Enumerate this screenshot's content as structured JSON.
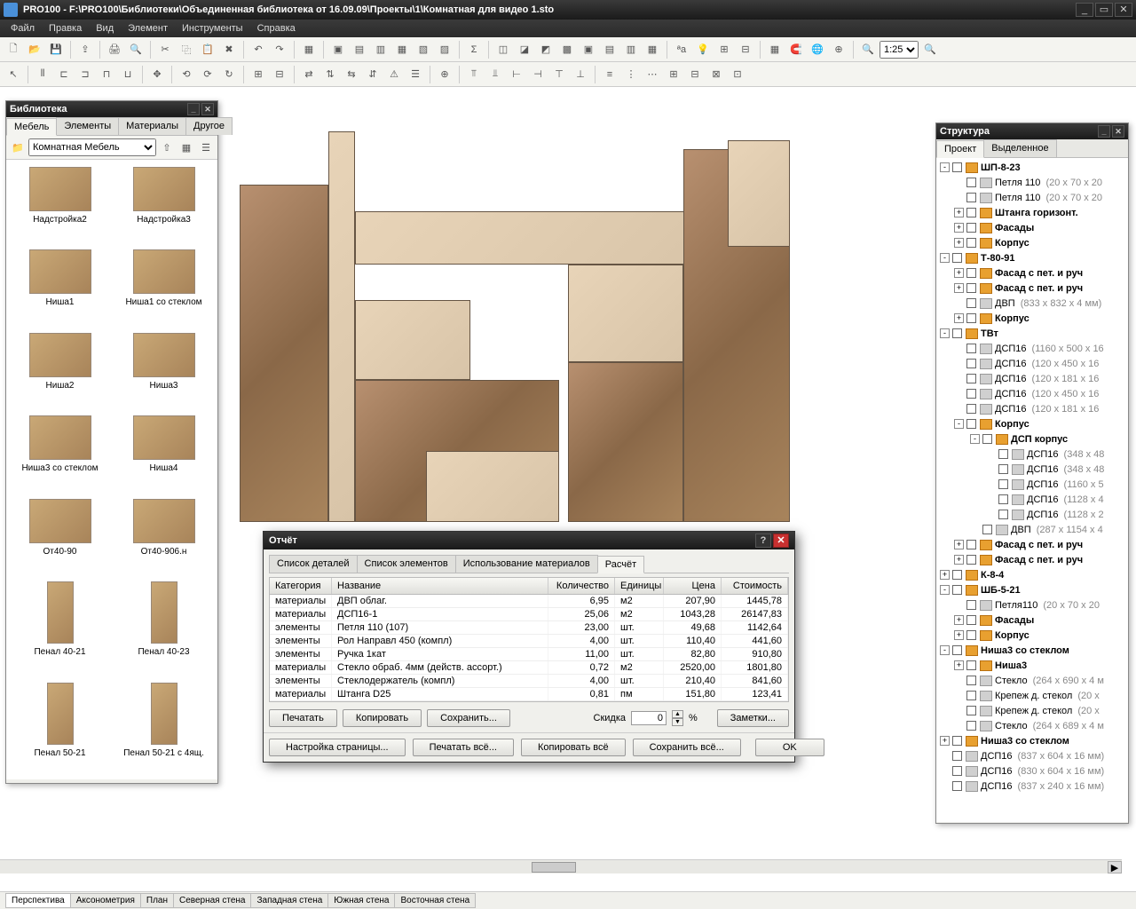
{
  "app": {
    "title": "PRO100 - F:\\PRO100\\Библиотеки\\Объединенная библиотека от 16.09.09\\Проекты\\1\\Комнатная для видео 1.sto"
  },
  "menu": [
    "Файл",
    "Правка",
    "Вид",
    "Элемент",
    "Инструменты",
    "Справка"
  ],
  "zoom": "1:25",
  "library": {
    "title": "Библиотека",
    "tabs": [
      "Мебель",
      "Элементы",
      "Материалы",
      "Другое"
    ],
    "active_tab": 0,
    "folder": "Комнатная Мебель",
    "items": [
      {
        "label": "Надстройка2"
      },
      {
        "label": "Надстройка3"
      },
      {
        "label": "Ниша1"
      },
      {
        "label": "Ниша1 со стеклом"
      },
      {
        "label": "Ниша2"
      },
      {
        "label": "Ниша3"
      },
      {
        "label": "Ниша3 со стеклом"
      },
      {
        "label": "Ниша4"
      },
      {
        "label": "От40-90"
      },
      {
        "label": "От40-906.н"
      },
      {
        "label": "Пенал 40-21",
        "tall": true
      },
      {
        "label": "Пенал 40-23",
        "tall": true
      },
      {
        "label": "Пенал 50-21",
        "tall": true
      },
      {
        "label": "Пенал 50-21 с 4ящ.",
        "tall": true
      }
    ]
  },
  "structure": {
    "title": "Структура",
    "tabs": [
      "Проект",
      "Выделенное"
    ],
    "active_tab": 0,
    "tree": [
      {
        "ind": 0,
        "exp": "-",
        "nm": "ШП-8-23",
        "grp": true
      },
      {
        "ind": 1,
        "nm": "Петля 110",
        "dim": "(20 x 70 x 20",
        "grp": false
      },
      {
        "ind": 1,
        "nm": "Петля 110",
        "dim": "(20 x 70 x 20",
        "grp": false
      },
      {
        "ind": 1,
        "exp": "+",
        "nm": "Штанга горизонт.",
        "grp": true
      },
      {
        "ind": 1,
        "exp": "+",
        "nm": "Фасады",
        "grp": true
      },
      {
        "ind": 1,
        "exp": "+",
        "nm": "Корпус",
        "grp": true
      },
      {
        "ind": 0,
        "exp": "-",
        "nm": "Т-80-91",
        "grp": true
      },
      {
        "ind": 1,
        "exp": "+",
        "nm": "Фасад с пет. и руч",
        "grp": true
      },
      {
        "ind": 1,
        "exp": "+",
        "nm": "Фасад с пет. и руч",
        "grp": true
      },
      {
        "ind": 1,
        "nm": "ДВП",
        "dim": "(833 x 832 x 4 мм)",
        "grp": false
      },
      {
        "ind": 1,
        "exp": "+",
        "nm": "Корпус",
        "grp": true
      },
      {
        "ind": 0,
        "exp": "-",
        "nm": "ТВт",
        "grp": true
      },
      {
        "ind": 1,
        "nm": "ДСП16",
        "dim": "(1160 x 500 x 16",
        "grp": false
      },
      {
        "ind": 1,
        "nm": "ДСП16",
        "dim": "(120 x 450 x 16",
        "grp": false
      },
      {
        "ind": 1,
        "nm": "ДСП16",
        "dim": "(120 x 181 x 16",
        "grp": false
      },
      {
        "ind": 1,
        "nm": "ДСП16",
        "dim": "(120 x 450 x 16",
        "grp": false
      },
      {
        "ind": 1,
        "nm": "ДСП16",
        "dim": "(120 x 181 x 16",
        "grp": false
      },
      {
        "ind": 1,
        "exp": "-",
        "nm": "Корпус",
        "grp": true
      },
      {
        "ind": 2,
        "exp": "-",
        "nm": "ДСП корпус",
        "grp": true
      },
      {
        "ind": 3,
        "nm": "ДСП16",
        "dim": "(348 x 48",
        "grp": false
      },
      {
        "ind": 3,
        "nm": "ДСП16",
        "dim": "(348 x 48",
        "grp": false
      },
      {
        "ind": 3,
        "nm": "ДСП16",
        "dim": "(1160 x 5",
        "grp": false
      },
      {
        "ind": 3,
        "nm": "ДСП16",
        "dim": "(1128 x 4",
        "grp": false
      },
      {
        "ind": 3,
        "nm": "ДСП16",
        "dim": "(1128 x 2",
        "grp": false
      },
      {
        "ind": 2,
        "nm": "ДВП",
        "dim": "(287 x 1154 x 4",
        "grp": false
      },
      {
        "ind": 1,
        "exp": "+",
        "nm": "Фасад с пет. и руч",
        "grp": true
      },
      {
        "ind": 1,
        "exp": "+",
        "nm": "Фасад с пет. и руч",
        "grp": true
      },
      {
        "ind": 0,
        "exp": "+",
        "nm": "К-8-4",
        "grp": true
      },
      {
        "ind": 0,
        "exp": "-",
        "nm": "ШБ-5-21",
        "grp": true
      },
      {
        "ind": 1,
        "nm": "Петля110",
        "dim": "(20 x 70 x 20",
        "grp": false
      },
      {
        "ind": 1,
        "exp": "+",
        "nm": "Фасады",
        "grp": true
      },
      {
        "ind": 1,
        "exp": "+",
        "nm": "Корпус",
        "grp": true
      },
      {
        "ind": 0,
        "exp": "-",
        "nm": "Ниша3 со стеклом",
        "grp": true
      },
      {
        "ind": 1,
        "exp": "+",
        "nm": "Ниша3",
        "grp": true
      },
      {
        "ind": 1,
        "nm": "Стекло",
        "dim": "(264 x 690 x 4 м",
        "grp": false
      },
      {
        "ind": 1,
        "nm": "Крепеж д. стекол",
        "dim": "(20 x",
        "grp": false
      },
      {
        "ind": 1,
        "nm": "Крепеж д. стекол",
        "dim": "(20 x",
        "grp": false
      },
      {
        "ind": 1,
        "nm": "Стекло",
        "dim": "(264 x 689 x 4 м",
        "grp": false
      },
      {
        "ind": 0,
        "exp": "+",
        "nm": "Ниша3 со стеклом",
        "grp": true
      },
      {
        "ind": 0,
        "nm": "ДСП16",
        "dim": "(837 x 604 x 16 мм)",
        "grp": false
      },
      {
        "ind": 0,
        "nm": "ДСП16",
        "dim": "(830 x 604 x 16 мм)",
        "grp": false
      },
      {
        "ind": 0,
        "nm": "ДСП16",
        "dim": "(837 x 240 x 16 мм)",
        "grp": false
      }
    ]
  },
  "report": {
    "title": "Отчёт",
    "tabs": [
      "Список деталей",
      "Список элементов",
      "Использование материалов",
      "Расчёт"
    ],
    "active_tab": 3,
    "headers": {
      "cat": "Категория",
      "name": "Название",
      "qty": "Количество",
      "unit": "Единицы",
      "price": "Цена",
      "cost": "Стоимость"
    },
    "rows": [
      {
        "cat": "материалы",
        "name": "ДВП облаг.",
        "qty": "6,95",
        "unit": "м2",
        "price": "207,90",
        "cost": "1445,78"
      },
      {
        "cat": "материалы",
        "name": "ДСП16-1",
        "qty": "25,06",
        "unit": "м2",
        "price": "1043,28",
        "cost": "26147,83"
      },
      {
        "cat": "элементы",
        "name": "Петля 110 (107)",
        "qty": "23,00",
        "unit": "шт.",
        "price": "49,68",
        "cost": "1142,64"
      },
      {
        "cat": "элементы",
        "name": "Рол Направл 450 (компл)",
        "qty": "4,00",
        "unit": "шт.",
        "price": "110,40",
        "cost": "441,60"
      },
      {
        "cat": "элементы",
        "name": "Ручка 1кат",
        "qty": "11,00",
        "unit": "шт.",
        "price": "82,80",
        "cost": "910,80"
      },
      {
        "cat": "материалы",
        "name": "Стекло обраб. 4мм (действ. ассорт.)",
        "qty": "0,72",
        "unit": "м2",
        "price": "2520,00",
        "cost": "1801,80"
      },
      {
        "cat": "элементы",
        "name": "Стеклодержатель (компл)",
        "qty": "4,00",
        "unit": "шт.",
        "price": "210,40",
        "cost": "841,60"
      },
      {
        "cat": "материалы",
        "name": "Штанга D25",
        "qty": "0,81",
        "unit": "пм",
        "price": "151,80",
        "cost": "123,41"
      }
    ],
    "buttons": {
      "print": "Печатать",
      "copy": "Копировать",
      "save": "Сохранить...",
      "notes": "Заметки..."
    },
    "discount": {
      "label": "Скидка",
      "value": "0",
      "unit": "%"
    },
    "bottom": {
      "page_setup": "Настройка страницы...",
      "print_all": "Печатать всё...",
      "copy_all": "Копировать всё",
      "save_all": "Сохранить всё...",
      "ok": "OK"
    }
  },
  "viewtabs": [
    "Перспектива",
    "Аксонометрия",
    "План",
    "Северная стена",
    "Западная стена",
    "Южная стена",
    "Восточная стена"
  ]
}
